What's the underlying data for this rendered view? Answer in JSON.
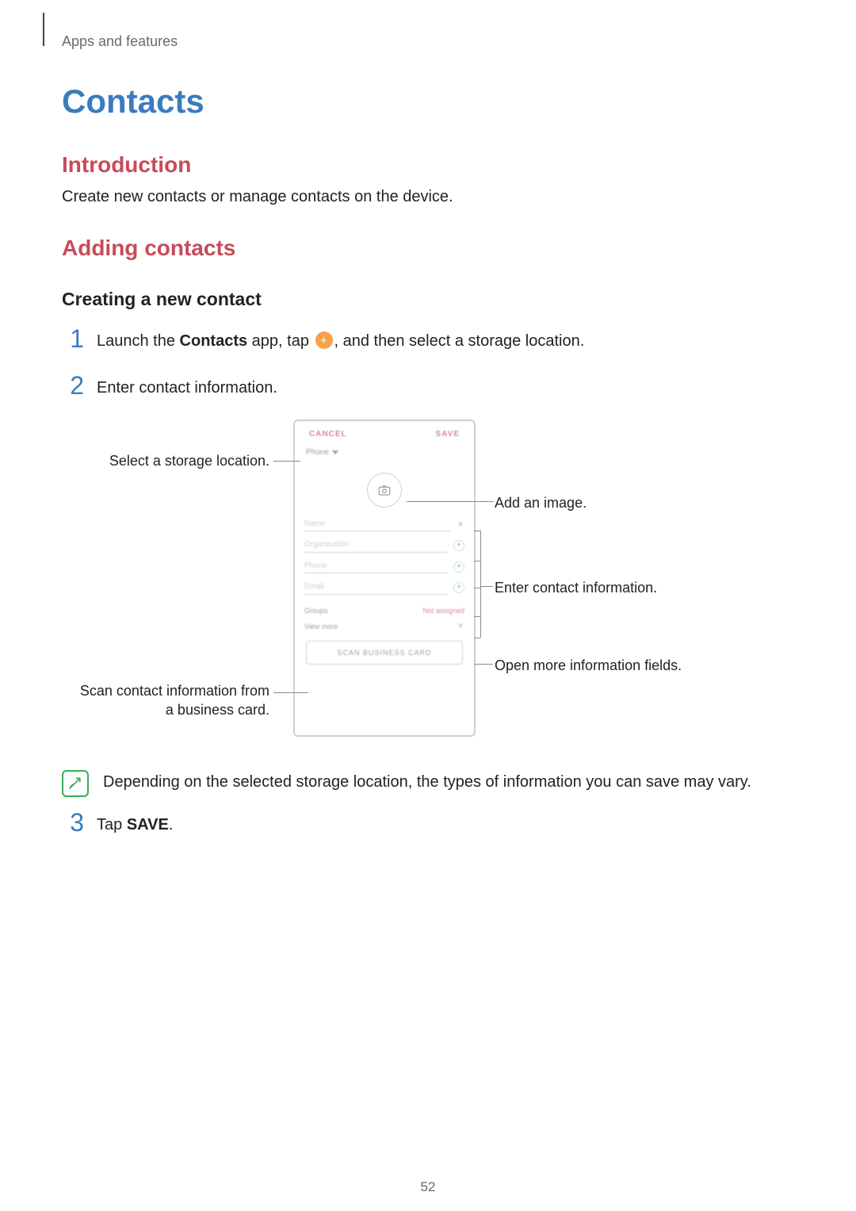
{
  "breadcrumb": "Apps and features",
  "title": "Contacts",
  "sections": {
    "intro": {
      "heading": "Introduction",
      "body": "Create new contacts or manage contacts on the device."
    },
    "adding": {
      "heading": "Adding contacts",
      "sub": "Creating a new contact",
      "steps": {
        "s1_pre": "Launch the ",
        "s1_bold": "Contacts",
        "s1_mid": " app, tap ",
        "s1_post": ", and then select a storage location.",
        "s2": "Enter contact information.",
        "s3_pre": "Tap ",
        "s3_bold": "SAVE",
        "s3_post": "."
      },
      "nums": {
        "n1": "1",
        "n2": "2",
        "n3": "3"
      }
    }
  },
  "phone": {
    "cancel": "CANCEL",
    "save": "SAVE",
    "storage": "Phone",
    "fields": {
      "name": "Name",
      "org": "Organisation",
      "phone": "Phone",
      "email": "Email"
    },
    "groups_label": "Groups",
    "groups_value": "Not assigned",
    "view_more": "View more",
    "scan": "SCAN BUSINESS CARD"
  },
  "callouts": {
    "storage": "Select a storage location.",
    "add_image": "Add an image.",
    "enter_info": "Enter contact information.",
    "more_fields": "Open more information fields.",
    "scan_card": "Scan contact information from a business card."
  },
  "note": "Depending on the selected storage location, the types of information you can save may vary.",
  "page_number": "52",
  "fab_plus": "+"
}
